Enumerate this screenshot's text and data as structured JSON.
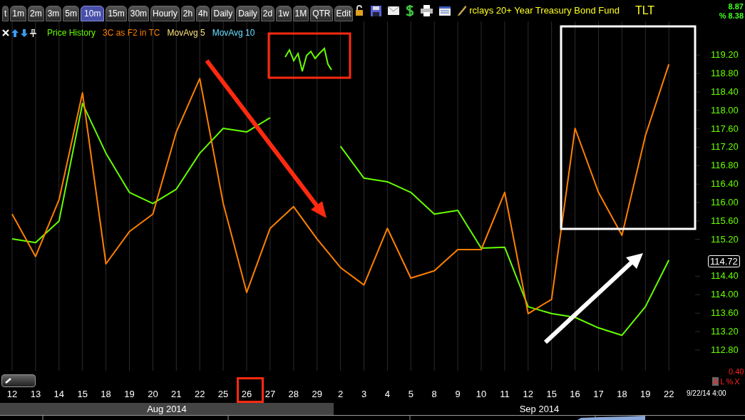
{
  "toolbar": {
    "tabs": [
      {
        "label": "t",
        "selected": false
      },
      {
        "label": "1m",
        "selected": false
      },
      {
        "label": "2m",
        "selected": false
      },
      {
        "label": "3m",
        "selected": false
      },
      {
        "label": "5m",
        "selected": false
      },
      {
        "label": "10m",
        "selected": true
      },
      {
        "label": "15m",
        "selected": false
      },
      {
        "label": "30m",
        "selected": false
      },
      {
        "label": "Hourly",
        "selected": false
      },
      {
        "label": "2h",
        "selected": false
      },
      {
        "label": "4h",
        "selected": false
      },
      {
        "label": "Daily",
        "selected": false
      },
      {
        "label": "Daily",
        "selected": false
      },
      {
        "label": "2d",
        "selected": false
      },
      {
        "label": "1w",
        "selected": false
      },
      {
        "label": "1M",
        "selected": false
      },
      {
        "label": "QTR",
        "selected": false
      },
      {
        "label": "Edit",
        "selected": false
      }
    ],
    "title": "rclays 20+ Year Treasury Bond Fund",
    "symbol": "TLT",
    "change": "8.87",
    "percent_change": "% 8.38"
  },
  "chart_data": {
    "type": "line",
    "categories": [
      "12",
      "13",
      "14",
      "15",
      "18",
      "19",
      "20",
      "21",
      "22",
      "25",
      "26",
      "27",
      "28",
      "29",
      "2",
      "3",
      "4",
      "5",
      "8",
      "9",
      "10",
      "11",
      "12",
      "15",
      "16",
      "17",
      "18",
      "19",
      "22"
    ],
    "ylim": [
      112.04,
      119.93
    ],
    "grid": true,
    "yticks": [
      {
        "value": 119.2,
        "label": "119.20"
      },
      {
        "value": 118.8,
        "label": "118.80"
      },
      {
        "value": 118.4,
        "label": "118.40"
      },
      {
        "value": 118.0,
        "label": "118.00"
      },
      {
        "value": 117.6,
        "label": "117.60"
      },
      {
        "value": 117.2,
        "label": "117.20"
      },
      {
        "value": 116.8,
        "label": "116.80"
      },
      {
        "value": 116.4,
        "label": "116.40"
      },
      {
        "value": 116.0,
        "label": "116.00"
      },
      {
        "value": 115.6,
        "label": "115.60"
      },
      {
        "value": 115.2,
        "label": "115.20"
      },
      {
        "value": 114.4,
        "label": "114.40"
      },
      {
        "value": 114.0,
        "label": "114.00"
      },
      {
        "value": 113.6,
        "label": "113.60"
      },
      {
        "value": 113.2,
        "label": "113.20"
      },
      {
        "value": 112.8,
        "label": "112.80"
      }
    ],
    "series": [
      {
        "name": "Price History",
        "color": "#66ff00",
        "values": [
          115.21,
          115.13,
          115.6,
          118.15,
          117.07,
          116.22,
          115.98,
          116.29,
          117.07,
          117.61,
          117.53,
          117.84,
          null,
          null,
          117.22,
          116.53,
          116.45,
          116.22,
          115.75,
          115.83,
          115.01,
          115.03,
          113.74,
          113.59,
          113.51,
          113.28,
          113.12,
          113.74,
          114.75
        ]
      },
      {
        "name": "3C as F2 in TC",
        "color": "#ff8000",
        "values": [
          115.75,
          114.83,
          116.06,
          118.38,
          114.67,
          115.37,
          115.75,
          117.53,
          118.69,
          115.98,
          114.05,
          115.44,
          115.91,
          115.21,
          114.59,
          114.21,
          115.44,
          114.36,
          114.52,
          114.98,
          114.98,
          116.22,
          113.59,
          113.9,
          117.61,
          116.22,
          115.29,
          117.45,
          119.0
        ]
      }
    ]
  },
  "legend": [
    {
      "label": "MovAvg 5",
      "color": "#ffe080"
    },
    {
      "label": "MovAvg 10",
      "color": "#66e0ff"
    }
  ],
  "current_price": "114.72",
  "months": [
    {
      "label": "Aug 2014",
      "selected": true
    },
    {
      "label": "Sep 2014",
      "selected": false
    }
  ],
  "scale": "0.40",
  "scale_buttons": [
    {
      "label": "A",
      "selected": true
    },
    {
      "label": "L",
      "selected": false
    },
    {
      "label": "%",
      "selected": false
    },
    {
      "label": "X",
      "selected": false
    }
  ],
  "timestamp": "9/22/14 4:00"
}
